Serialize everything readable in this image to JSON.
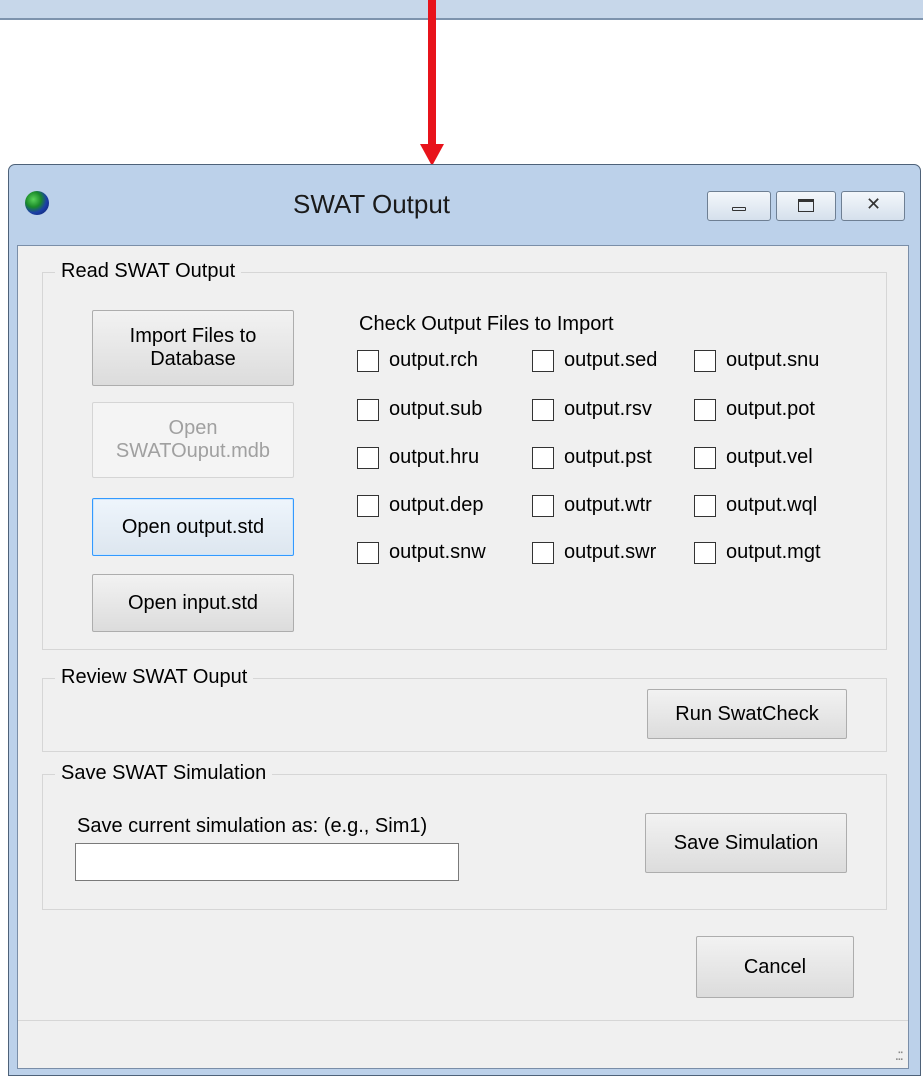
{
  "window": {
    "title": "SWAT Output"
  },
  "read_group": {
    "legend": "Read SWAT Output",
    "import_button": "Import Files to Database",
    "open_mdb_button": "Open SWATOuput.mdb",
    "open_output_std_button": "Open output.std",
    "open_input_std_button": "Open input.std",
    "check_label": "Check Output Files to Import",
    "files": [
      "output.rch",
      "output.sed",
      "output.snu",
      "output.sub",
      "output.rsv",
      "output.pot",
      "output.hru",
      "output.pst",
      "output.vel",
      "output.dep",
      "output.wtr",
      "output.wql",
      "output.snw",
      "output.swr",
      "output.mgt"
    ]
  },
  "review_group": {
    "legend": "Review SWAT Ouput",
    "run_button": "Run SwatCheck"
  },
  "save_group": {
    "legend": "Save SWAT Simulation",
    "prompt": "Save current simulation as: (e.g., Sim1)",
    "input_value": "",
    "save_button": "Save Simulation"
  },
  "footer": {
    "cancel_button": "Cancel"
  },
  "colors": {
    "arrow": "#e8131b",
    "window_frame": "#bcd1ea",
    "client_bg": "#f0f0f0",
    "focus_border": "#3399ff"
  },
  "icons": [
    "globe-icon",
    "minimize-icon",
    "maximize-icon",
    "close-icon",
    "resize-grip-icon"
  ]
}
